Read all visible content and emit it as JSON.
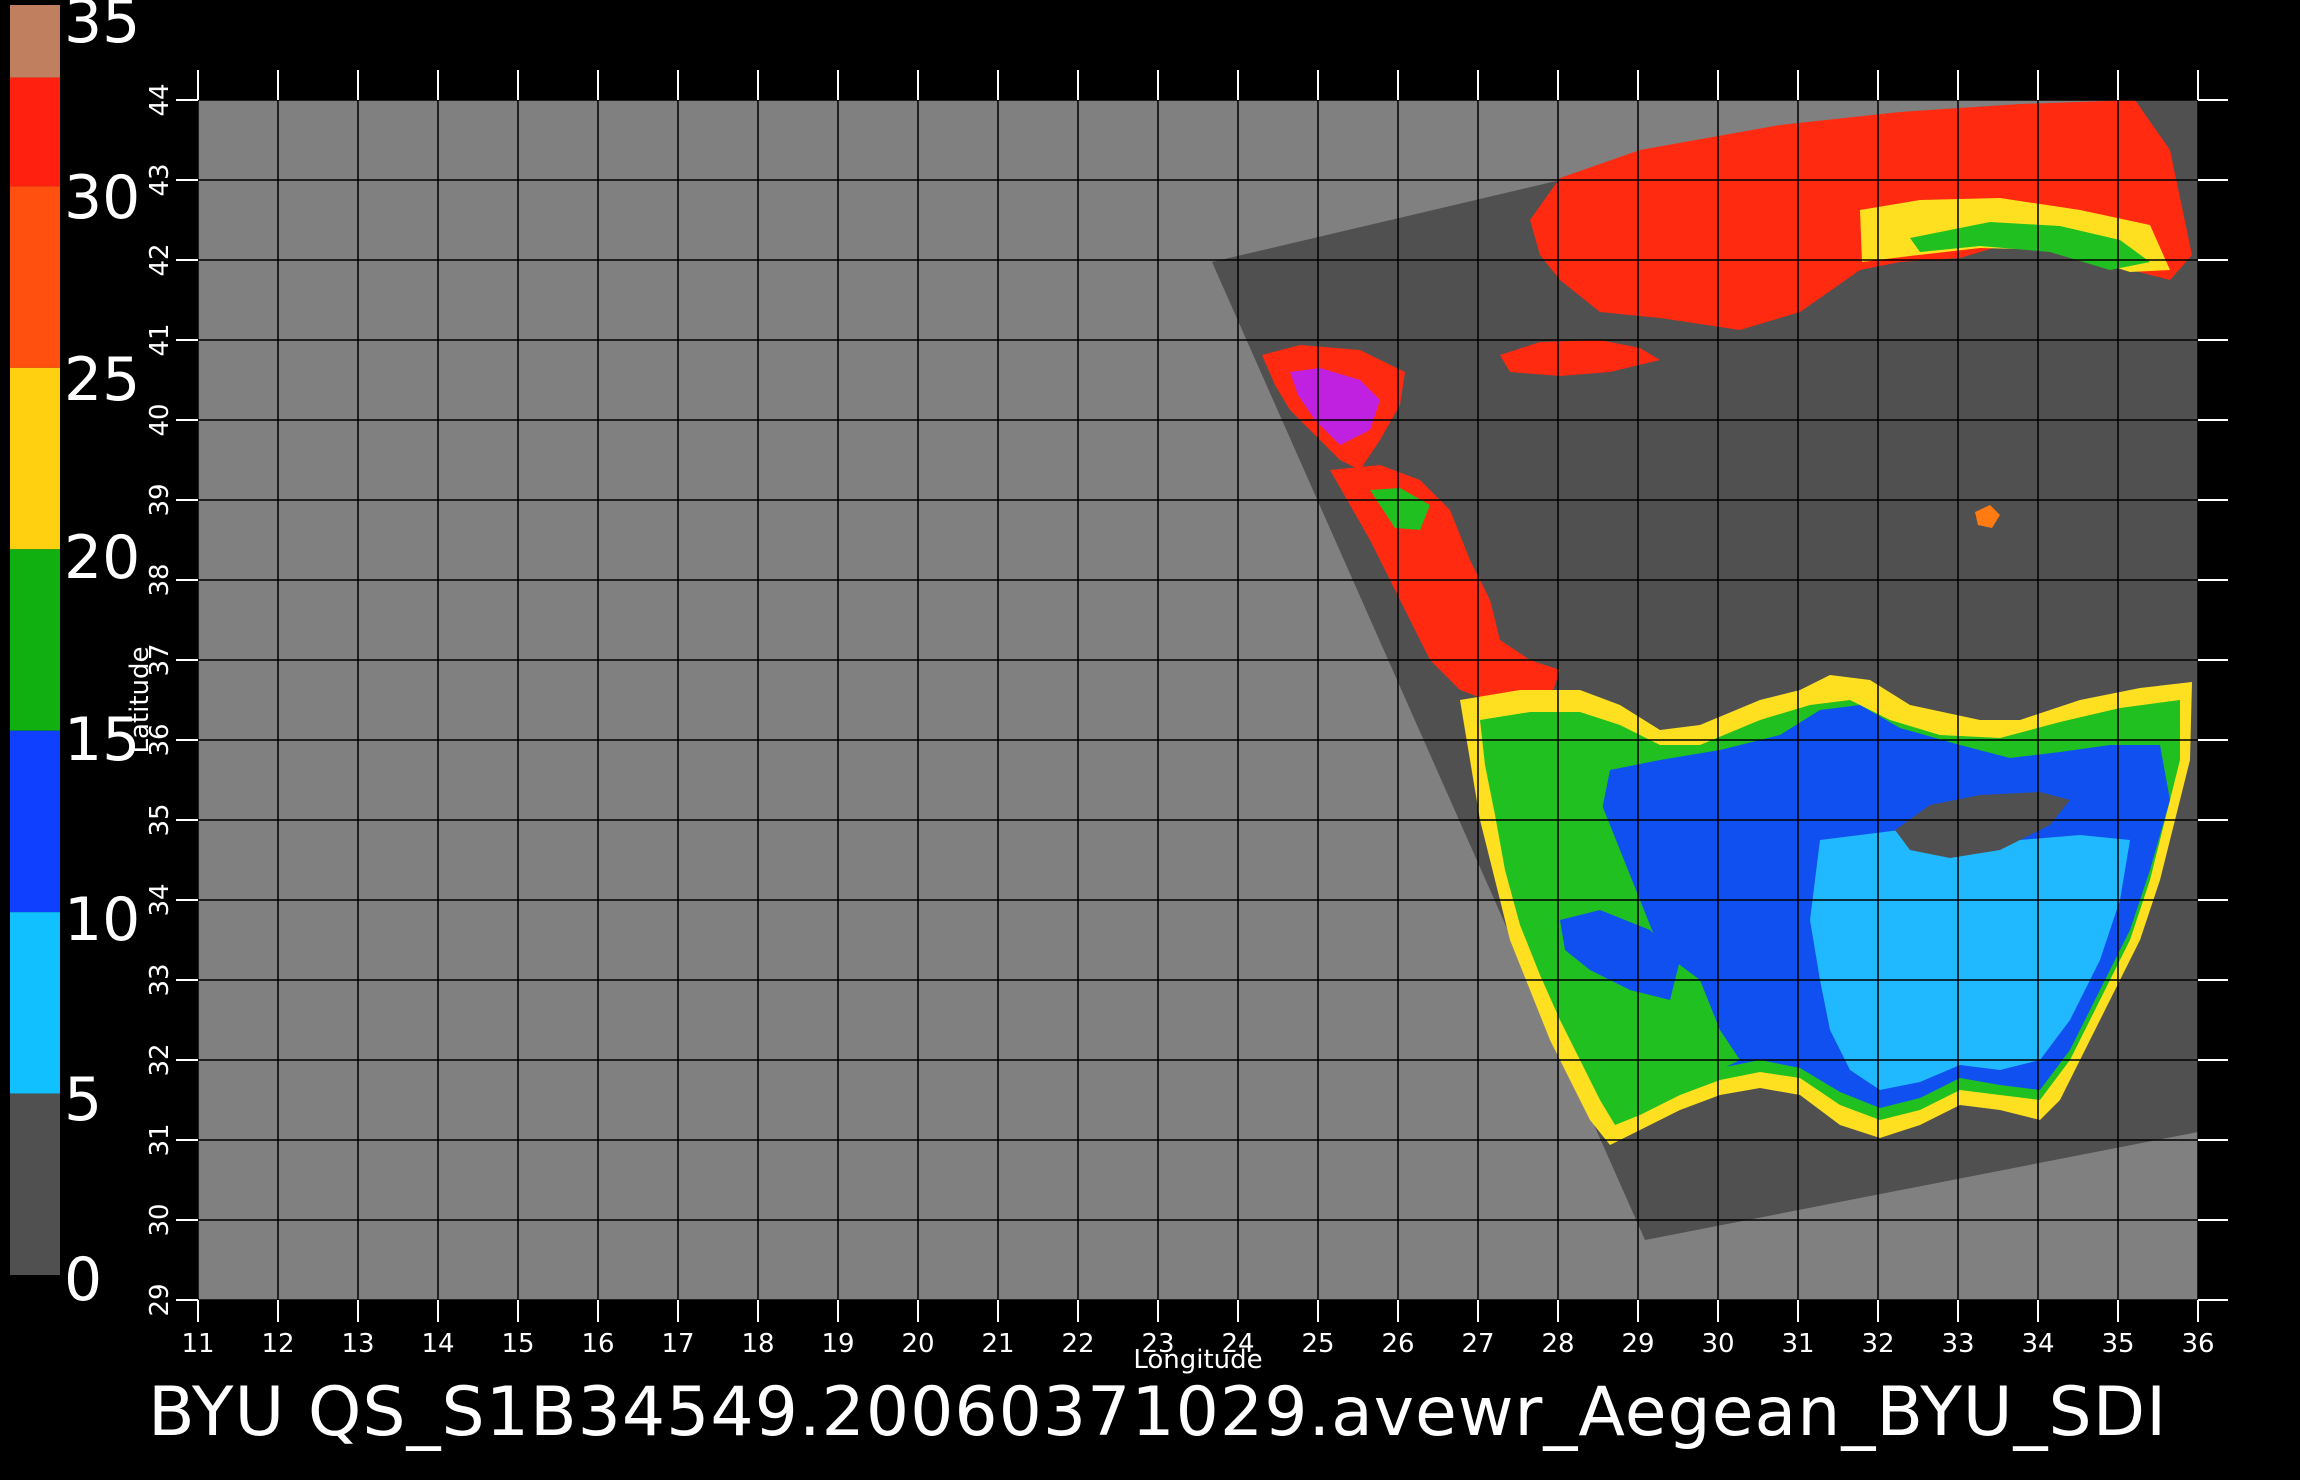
{
  "caption": "BYU  QS_S1B34549.20060371029.avewr_Aegean_BYU_SDI",
  "map": {
    "lon_range": [
      11,
      36
    ],
    "lat_range": [
      29,
      44
    ],
    "xlabel": "Longitude",
    "ylabel": "Latitude",
    "lon_ticks": [
      11,
      12,
      13,
      14,
      15,
      16,
      17,
      18,
      19,
      20,
      21,
      22,
      23,
      24,
      25,
      26,
      27,
      28,
      29,
      30,
      31,
      32,
      33,
      34,
      35,
      36
    ],
    "lat_ticks": [
      29,
      30,
      31,
      32,
      33,
      34,
      35,
      36,
      37,
      38,
      39,
      40,
      41,
      42,
      43,
      44
    ],
    "background_color": "#808080",
    "swath_color": "#505050",
    "grid_color": "#000000"
  },
  "colorbar": {
    "labels": [
      "35",
      "30",
      "25",
      "20",
      "15",
      "10",
      "5",
      "0"
    ],
    "range": [
      0,
      35
    ],
    "segments": [
      {
        "from": 33,
        "to": 35,
        "color": "#c08060"
      },
      {
        "from": 30,
        "to": 33,
        "color": "#ff2010"
      },
      {
        "from": 25,
        "to": 30,
        "color": "#ff5010"
      },
      {
        "from": 20,
        "to": 25,
        "color": "#ffd010"
      },
      {
        "from": 15,
        "to": 20,
        "color": "#10b010"
      },
      {
        "from": 10,
        "to": 15,
        "color": "#1040ff"
      },
      {
        "from": 5,
        "to": 10,
        "color": "#10c0ff"
      },
      {
        "from": 0,
        "to": 5,
        "color": "#505050"
      }
    ]
  },
  "legend_colors": {
    "red": "#ff2a10",
    "orange": "#ff7a10",
    "yellow": "#ffe020",
    "green": "#20c020",
    "blue": "#1050f0",
    "cyan": "#20b8ff",
    "magenta": "#c020e0"
  }
}
